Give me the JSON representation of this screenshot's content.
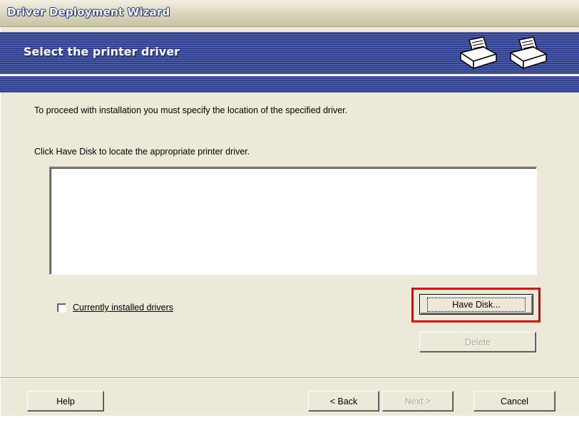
{
  "window": {
    "title": "Driver Deployment Wizard"
  },
  "banner": {
    "heading": "Select the printer driver",
    "icons": [
      "printer-icon",
      "printer-icon"
    ]
  },
  "instructions": {
    "line1": "To proceed with installation you must specify the location of the specified driver.",
    "line2": "Click Have Disk to locate the appropriate printer driver."
  },
  "driver_list": {
    "items": []
  },
  "checkbox": {
    "label": "Currently installed drivers",
    "checked": false
  },
  "buttons": {
    "have_disk": "Have Disk...",
    "delete": "Delete",
    "help": "Help",
    "back": "< Back",
    "next": "Next >",
    "cancel": "Cancel"
  },
  "colors": {
    "highlight": "#e00000",
    "banner": "#2f3f92",
    "dialog_bg": "#ece9d8"
  }
}
